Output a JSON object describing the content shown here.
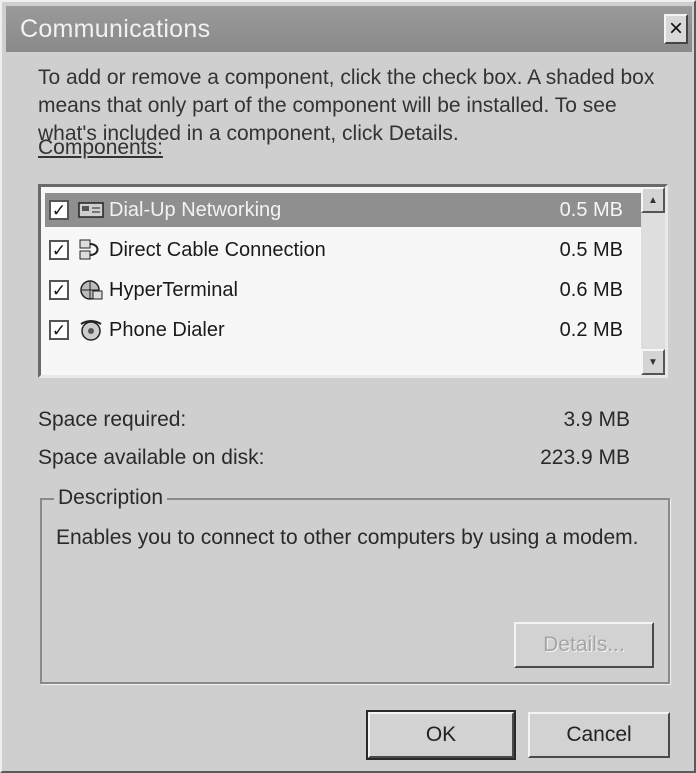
{
  "window": {
    "title": "Communications"
  },
  "intro_text": "To add or remove a component, click the check box. A shaded box means that only part of the component will be installed. To see what's included in a component, click Details.",
  "components_label": "Components:",
  "components": [
    {
      "name": "Dial-Up Networking",
      "size": "0.5 MB",
      "checked": true,
      "selected": true,
      "icon": "dial-up-networking-icon"
    },
    {
      "name": "Direct Cable Connection",
      "size": "0.5 MB",
      "checked": true,
      "selected": false,
      "icon": "direct-cable-connection-icon"
    },
    {
      "name": "HyperTerminal",
      "size": "0.6 MB",
      "checked": true,
      "selected": false,
      "icon": "hyperterminal-icon"
    },
    {
      "name": "Phone Dialer",
      "size": "0.2 MB",
      "checked": true,
      "selected": false,
      "icon": "phone-dialer-icon"
    }
  ],
  "space_required": {
    "label": "Space required:",
    "value": "3.9 MB"
  },
  "space_available": {
    "label": "Space available on disk:",
    "value": "223.9 MB"
  },
  "description": {
    "legend": "Description",
    "text": "Enables you to connect to other computers by using a modem."
  },
  "buttons": {
    "details": "Details...",
    "ok": "OK",
    "cancel": "Cancel"
  },
  "colors": {
    "titlebar": "#8f8f8f",
    "selection": "#8f8f8f",
    "dialog_bg": "#cfcfcf"
  }
}
